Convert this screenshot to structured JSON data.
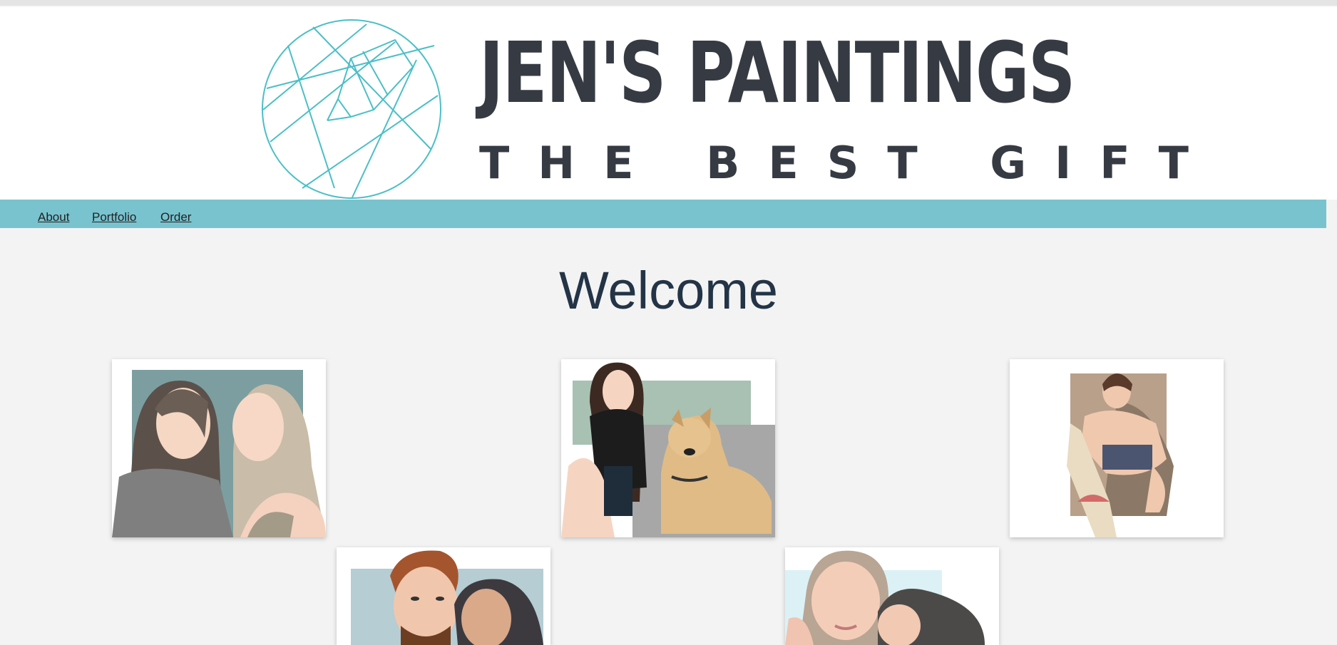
{
  "logo": {
    "title": "JEN'S PAINTINGS",
    "tagline": "THE BEST GIFT",
    "icon": "pencil-geometric-circle-icon",
    "accent": "#4bbfc6",
    "text_color": "#363a43"
  },
  "nav": {
    "items": [
      {
        "label": "About"
      },
      {
        "label": "Portfolio"
      },
      {
        "label": "Order"
      }
    ],
    "background": "#79c3cf"
  },
  "main": {
    "heading": "Welcome",
    "gallery": [
      {
        "name": "portrait-two-women"
      },
      {
        "name": "portrait-woman-with-dog"
      },
      {
        "name": "portrait-man-with-dog"
      },
      {
        "name": "portrait-couple"
      },
      {
        "name": "portrait-two-women-kissing"
      }
    ]
  }
}
